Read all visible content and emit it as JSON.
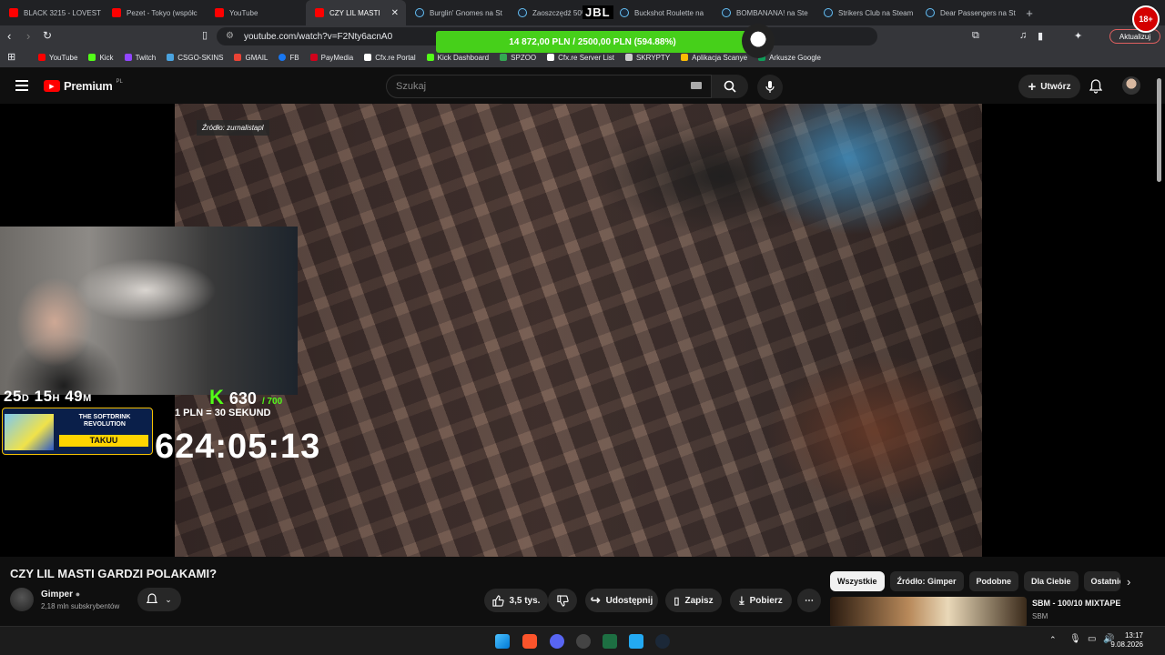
{
  "browser": {
    "tabs": [
      {
        "label": "BLACK 3215 - LOVEST",
        "favicon": "youtube-icon"
      },
      {
        "label": "Pezet - Tokyo (współc",
        "favicon": "youtube-icon"
      },
      {
        "label": "YouTube",
        "favicon": "youtube-icon"
      },
      {
        "label": "CZY LIL MASTI",
        "favicon": "youtube-icon",
        "active": true
      },
      {
        "label": "Burglin' Gnomes na St",
        "favicon": "steam-icon"
      },
      {
        "label": "Zaoszczędź 50%",
        "favicon": "steam-icon"
      },
      {
        "label": "Buckshot Roulette na",
        "favicon": "steam-icon"
      },
      {
        "label": "BOMBANANA! na Ste",
        "favicon": "steam-icon"
      },
      {
        "label": "Strikers Club na Steam",
        "favicon": "steam-icon"
      },
      {
        "label": "Dear Passengers na St",
        "favicon": "steam-icon"
      }
    ],
    "url": "youtube.com/watch?v=F2Nty6acnA0",
    "update_label": "Aktualizuj",
    "bookmarks": [
      {
        "label": "YouTube",
        "color": "#ff0000"
      },
      {
        "label": "Kick",
        "color": "#53fc18"
      },
      {
        "label": "Twitch",
        "color": "#9146ff"
      },
      {
        "label": "CSGO-SKINS",
        "color": "#4aa3df"
      },
      {
        "label": "GMAIL",
        "color": "#ea4335"
      },
      {
        "label": "FB",
        "color": "#1877f2"
      },
      {
        "label": "PayMedia",
        "color": "#d0021b"
      },
      {
        "label": "Cfx.re Portal",
        "color": "#ffffff"
      },
      {
        "label": "Kick Dashboard",
        "color": "#53fc18"
      },
      {
        "label": "SPZOO",
        "color": "#34a853"
      },
      {
        "label": "Cfx.re Server List",
        "color": "#ffffff"
      },
      {
        "label": "SKRYPTY",
        "color": "#cccccc"
      },
      {
        "label": "Aplikacja Scanye",
        "color": "#fbbc05"
      },
      {
        "label": "Arkusze Google",
        "color": "#0f9d58"
      }
    ]
  },
  "overlay": {
    "donation_text": "14 872,00 PLN / 2500,00 PLN (594.88%)",
    "jbl": "JBL",
    "age_badge": "18+"
  },
  "youtube": {
    "logo_text": "Premium",
    "logo_region": "PL",
    "search_placeholder": "Szukaj",
    "create_label": "Utwórz"
  },
  "video": {
    "source_tag": "Źródło: zurnalistapl",
    "timer_days": "25",
    "timer_hours": "15",
    "timer_minutes": "49",
    "unit_days": "D",
    "unit_hours": "H",
    "unit_minutes": "M",
    "kick_logo": "K",
    "kick_count": "630",
    "kick_max": "/ 700",
    "rate": "1 PLN = 30 SEKUND",
    "promo_title": "THE SOFTDRINK REVOLUTION",
    "promo_cta": "TAKUU",
    "big_timer": "624:05:13"
  },
  "meta": {
    "title": "CZY LIL MASTI GARDZI POLAKAMI?",
    "channel": "Gimper",
    "subscribers": "2,18 mln subskrybentów",
    "likes": "3,5 tys.",
    "share": "Udostępnij",
    "save": "Zapisz",
    "download": "Pobierz"
  },
  "sidebar": {
    "chips": [
      "Wszystkie",
      "Źródło: Gimper",
      "Podobne",
      "Dla Ciebie",
      "Ostatnio"
    ],
    "rec_title": "SBM - 100/10 MIXTAPE",
    "rec_channel": "SBM"
  },
  "taskbar": {
    "time": "13:17",
    "date": "9.08.2026"
  }
}
